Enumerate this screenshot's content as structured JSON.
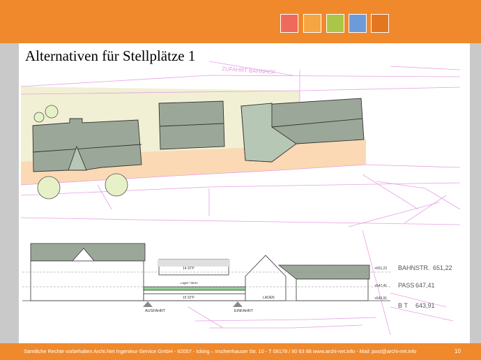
{
  "slide": {
    "title": "Alternativen für Stellplätze 1",
    "page_number": "10",
    "footer": "Sämtliche Rechte vorbehalten  Archi.Net Ingenieur-Service GmbH  - 82057  - Icking – Irschenhauser Str. 10 -  T 08178 / 90 63 88  www.archi-net.info -  Mail: post@archi-net.info"
  },
  "header": {
    "swatches": [
      "#ef6a5a",
      "#f5a542",
      "#a9c648",
      "#6b9bd8",
      "#e3761f"
    ]
  },
  "site_plan": {
    "road_label": "ZUFAHRT BAHNHOF"
  },
  "section": {
    "parking_upper": "14 STP",
    "deck_label": "Lager / Büro",
    "parking_lower": "15 STP",
    "shop_label": "LADEN",
    "exit_label": "AUSFAHRT",
    "entry_label": "EINFAHRT",
    "levels": [
      {
        "mark": "+651,22",
        "name": "BAHNSTR.",
        "value": "651,22"
      },
      {
        "mark": "+647,41",
        "name": "PASS",
        "value": "647,41"
      },
      {
        "mark": "+643,91",
        "name": "B T",
        "value": "643,91"
      }
    ]
  }
}
